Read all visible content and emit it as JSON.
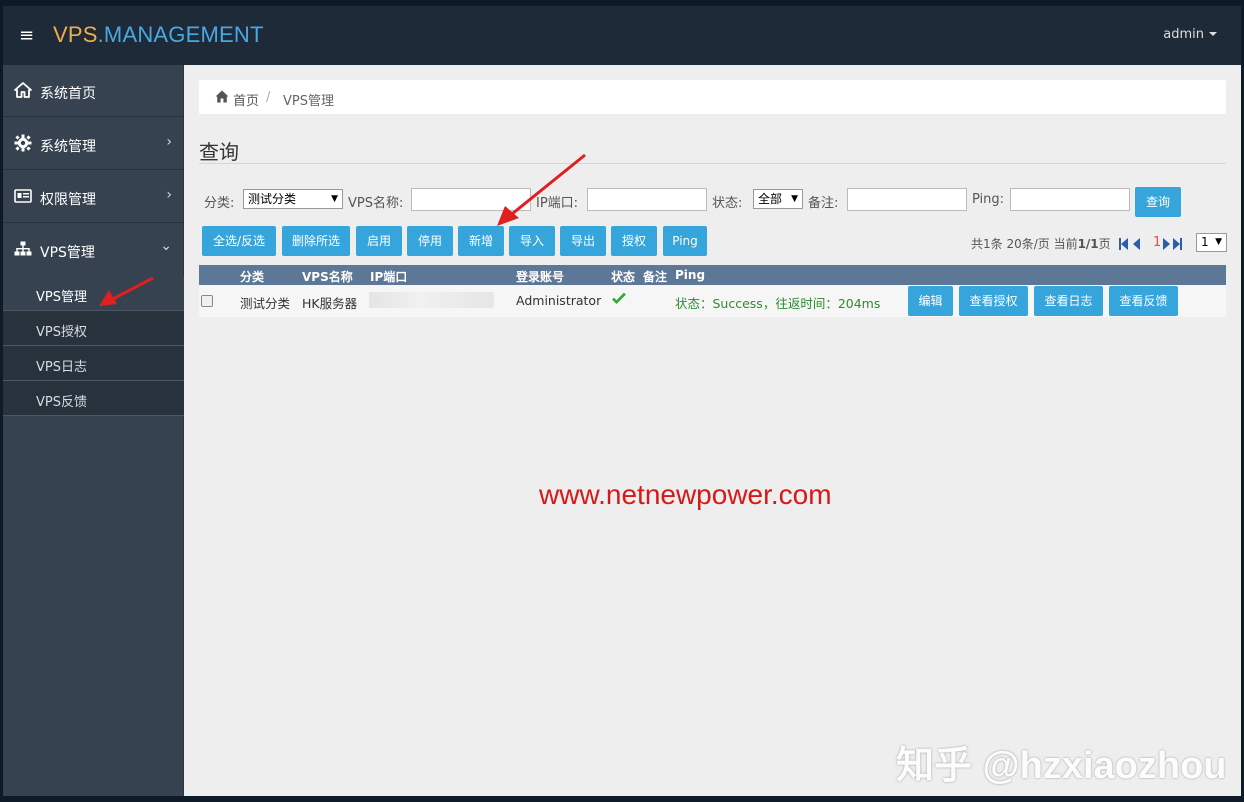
{
  "topbar": {
    "brand_part1": "VPS",
    "brand_part2": ".MANAGEMENT",
    "user": "admin",
    "colors": {
      "background": "#1e2a38",
      "brand_orange": "#f0ad4e",
      "brand_blue": "#4aa8e0"
    }
  },
  "sidebar": {
    "items": [
      {
        "label": "系统首页",
        "icon": "home-icon",
        "has_arrow": false
      },
      {
        "label": "系统管理",
        "icon": "gear-icon",
        "has_arrow": true,
        "arrow": "›"
      },
      {
        "label": "权限管理",
        "icon": "id-card-icon",
        "has_arrow": true,
        "arrow": "›"
      },
      {
        "label": "VPS管理",
        "icon": "sitemap-icon",
        "has_arrow": true,
        "arrow": "⌄",
        "expanded": true
      }
    ],
    "sub_items": [
      {
        "label": "VPS管理",
        "active": true
      },
      {
        "label": "VPS授权",
        "active": false
      },
      {
        "label": "VPS日志",
        "active": false
      },
      {
        "label": "VPS反馈",
        "active": false
      }
    ]
  },
  "breadcrumb": {
    "home": "首页",
    "separator": "/",
    "current": "VPS管理"
  },
  "page_title": "查询",
  "filters": {
    "category_label": "分类:",
    "category_value": "测试分类",
    "vps_name_label": "VPS名称:",
    "vps_name_value": "",
    "ip_port_label": "IP端口:",
    "ip_port_value": "",
    "status_label": "状态:",
    "status_value": "全部",
    "remark_label": "备注:",
    "remark_value": "",
    "ping_label": "Ping:",
    "ping_value": "",
    "query_button": "查询"
  },
  "toolbar": {
    "select_all": "全选/反选",
    "delete_selected": "删除所选",
    "enable": "启用",
    "disable": "停用",
    "add": "新增",
    "import": "导入",
    "export": "导出",
    "authorize": "授权",
    "ping": "Ping"
  },
  "pager": {
    "summary_prefix": "共1条 20条/页 当前",
    "summary_page": "1/1",
    "summary_suffix": "页",
    "current_page": "1",
    "page_select": "1"
  },
  "table": {
    "headers": [
      "分类",
      "VPS名称",
      "IP端口",
      "登录账号",
      "状态",
      "备注",
      "Ping"
    ],
    "rows": [
      {
        "category": "测试分类",
        "name": "HK服务器",
        "ip_port": "",
        "account": "Administrator",
        "status_icon": "check-icon",
        "remark": "",
        "ping": "状态：Success，往返时间：204ms",
        "actions": [
          "编辑",
          "查看授权",
          "查看日志",
          "查看反馈"
        ]
      }
    ]
  },
  "watermarks": {
    "site": "www.netnewpower.com",
    "zhihu": "知乎 @hzxiaozhou"
  },
  "colors": {
    "button": "#36a5dc",
    "table_header": "#5d7796",
    "sidebar": "#36424f",
    "status_ok": "#2e8b2e",
    "watermark": "#d71818"
  }
}
